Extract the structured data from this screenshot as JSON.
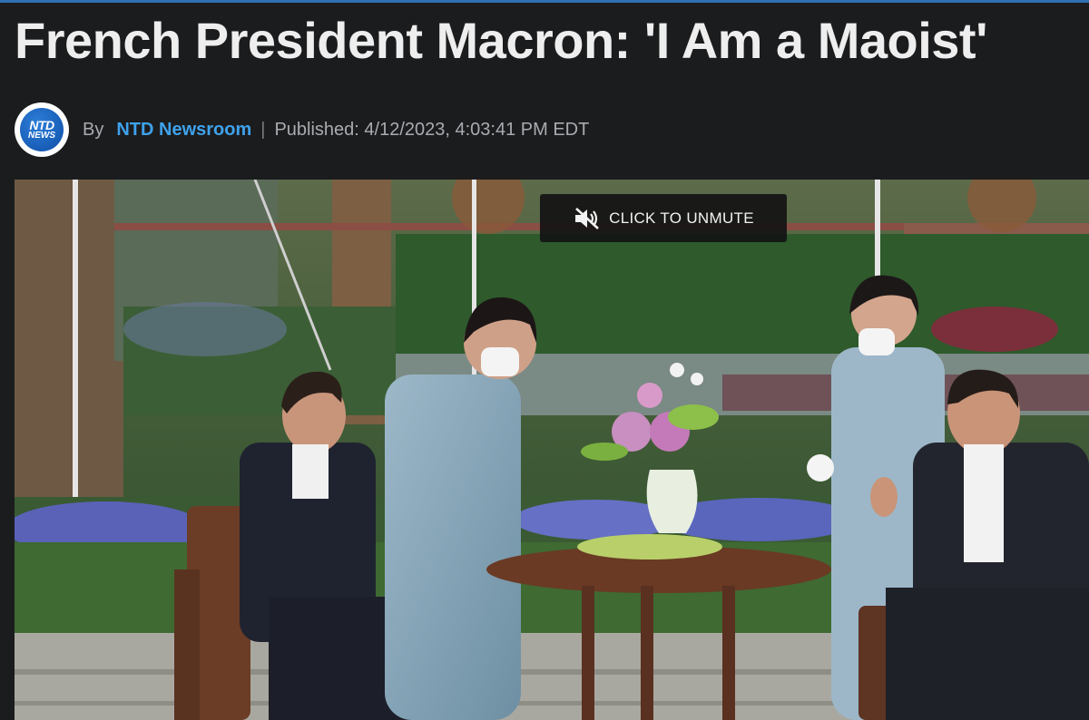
{
  "article": {
    "title": "French President Macron: 'I Am a Maoist'"
  },
  "byline": {
    "logo_top": "NTD",
    "logo_bottom": "NEWS",
    "by_label": "By",
    "author": "NTD Newsroom",
    "separator": "|",
    "published": "Published: 4/12/2023, 4:03:41 PM EDT"
  },
  "video": {
    "unmute_label": "CLICK TO UNMUTE",
    "unmute_icon": "speaker-muted-icon"
  },
  "colors": {
    "background": "#1b1c1e",
    "accent": "#3fa2ec",
    "top_rule": "#2f6fb3"
  }
}
